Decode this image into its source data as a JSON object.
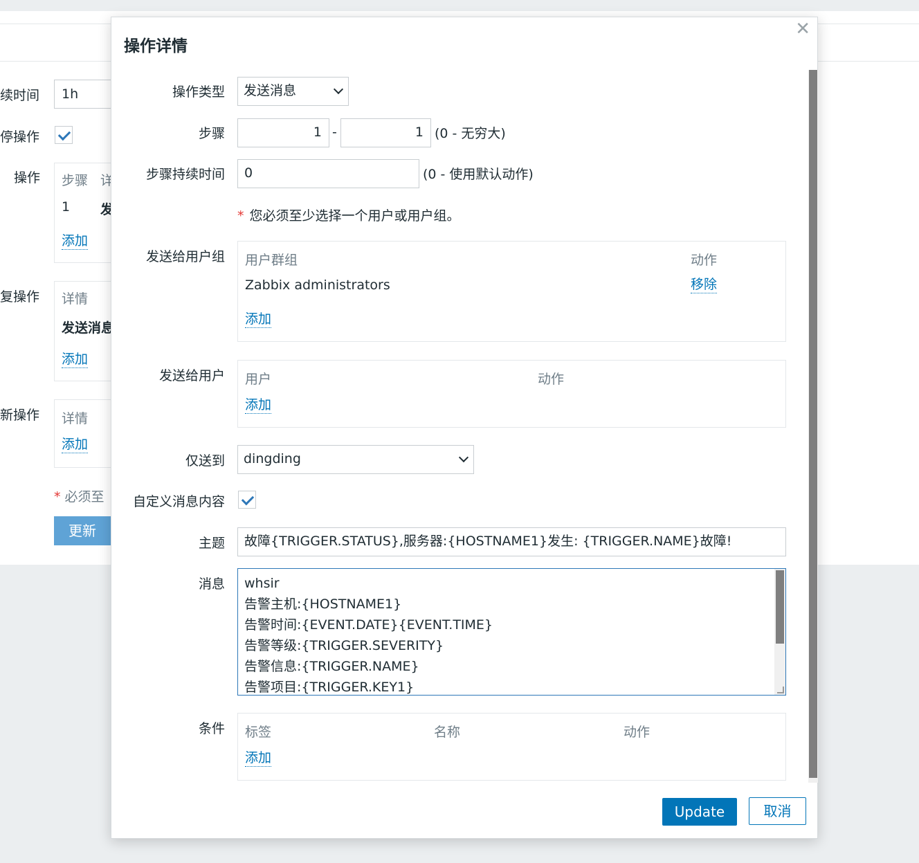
{
  "background": {
    "labels": [
      "续时间",
      "停操作",
      "操作",
      "复操作",
      "新操作"
    ],
    "duration_value": "1h",
    "ops_headers": [
      "步骤",
      "详"
    ],
    "ops_row": [
      "1",
      "发"
    ],
    "add_link": "添加",
    "recovery_header": "详情",
    "recovery_row": "发送消息",
    "update_header": "详情",
    "note": "必须至",
    "update_button": "更新"
  },
  "dialog": {
    "title": "操作详情",
    "close_icon": "close-icon",
    "operation_type": {
      "label": "操作类型",
      "value": "发送消息"
    },
    "steps": {
      "label": "步骤",
      "from": "1",
      "separator": "-",
      "to": "1",
      "hint": "(0 - 无穷大)"
    },
    "step_duration": {
      "label": "步骤持续时间",
      "value": "0",
      "hint": "(0 - 使用默认动作)"
    },
    "required_note": "您必须至少选择一个用户或用户组。",
    "user_groups": {
      "label": "发送给用户组",
      "col_group": "用户群组",
      "col_action": "动作",
      "rows": [
        {
          "name": "Zabbix administrators",
          "action": "移除"
        }
      ],
      "add": "添加"
    },
    "users": {
      "label": "发送给用户",
      "col_user": "用户",
      "col_action": "动作",
      "add": "添加"
    },
    "send_only_to": {
      "label": "仅送到",
      "value": "dingding"
    },
    "custom_message": {
      "label": "自定义消息内容",
      "checked": true
    },
    "subject": {
      "label": "主题",
      "value": "故障{TRIGGER.STATUS},服务器:{HOSTNAME1}发生: {TRIGGER.NAME}故障!"
    },
    "message": {
      "label": "消息",
      "lines": [
        "whsir",
        "告警主机:{HOSTNAME1}",
        "告警时间:{EVENT.DATE}{EVENT.TIME}",
        "告警等级:{TRIGGER.SEVERITY}",
        "告警信息:{TRIGGER.NAME}",
        "告警项目:{TRIGGER.KEY1}"
      ]
    },
    "conditions": {
      "label": "条件",
      "col_tag": "标签",
      "col_name": "名称",
      "col_action": "动作",
      "add": "添加"
    },
    "buttons": {
      "update": "Update",
      "cancel": "取消"
    }
  },
  "colors": {
    "primary": "#0275b8",
    "required_star": "#e33734",
    "header_text": "#6f7e88"
  }
}
